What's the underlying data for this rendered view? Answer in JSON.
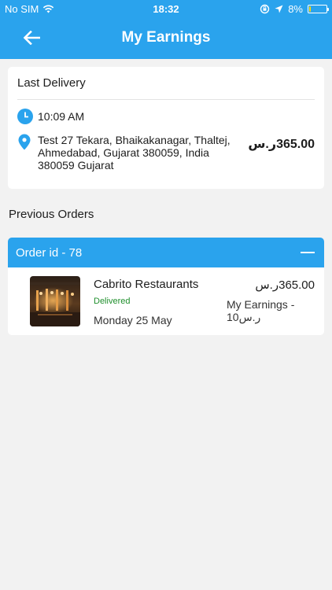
{
  "status_bar": {
    "carrier": "No SIM",
    "time": "18:32",
    "battery_percent": "8%",
    "battery_level": 0.08,
    "battery_color": "#ffd60a",
    "icons": [
      "wifi-icon",
      "orientation-lock-icon",
      "location-arrow-icon",
      "battery-icon"
    ]
  },
  "header": {
    "title": "My Earnings",
    "back_icon": "back-arrow-icon",
    "background": "#2aa3ed"
  },
  "last_delivery": {
    "title": "Last Delivery",
    "time": "10:09 AM",
    "address": "Test 27 Tekara, Bhaikakanagar, Thaltej, Ahmedabad, Gujarat 380059, India 380059 Gujarat",
    "amount": "365.00ر.س",
    "icons": [
      "clock-icon",
      "location-pin-icon"
    ]
  },
  "previous_orders": {
    "heading": "Previous Orders",
    "orders": [
      {
        "order_id": "Order id - 78",
        "restaurant": "Cabrito Restaurants",
        "status": "Delivered",
        "date": "Monday 25 May",
        "amount": "365.00ر.س",
        "earnings_label": "My Earnings - ",
        "earnings_value": "ر.س10",
        "status_color": "#1f8f2c"
      }
    ]
  },
  "colors": {
    "accent": "#2aa3ed",
    "background": "#f2f2f2"
  }
}
